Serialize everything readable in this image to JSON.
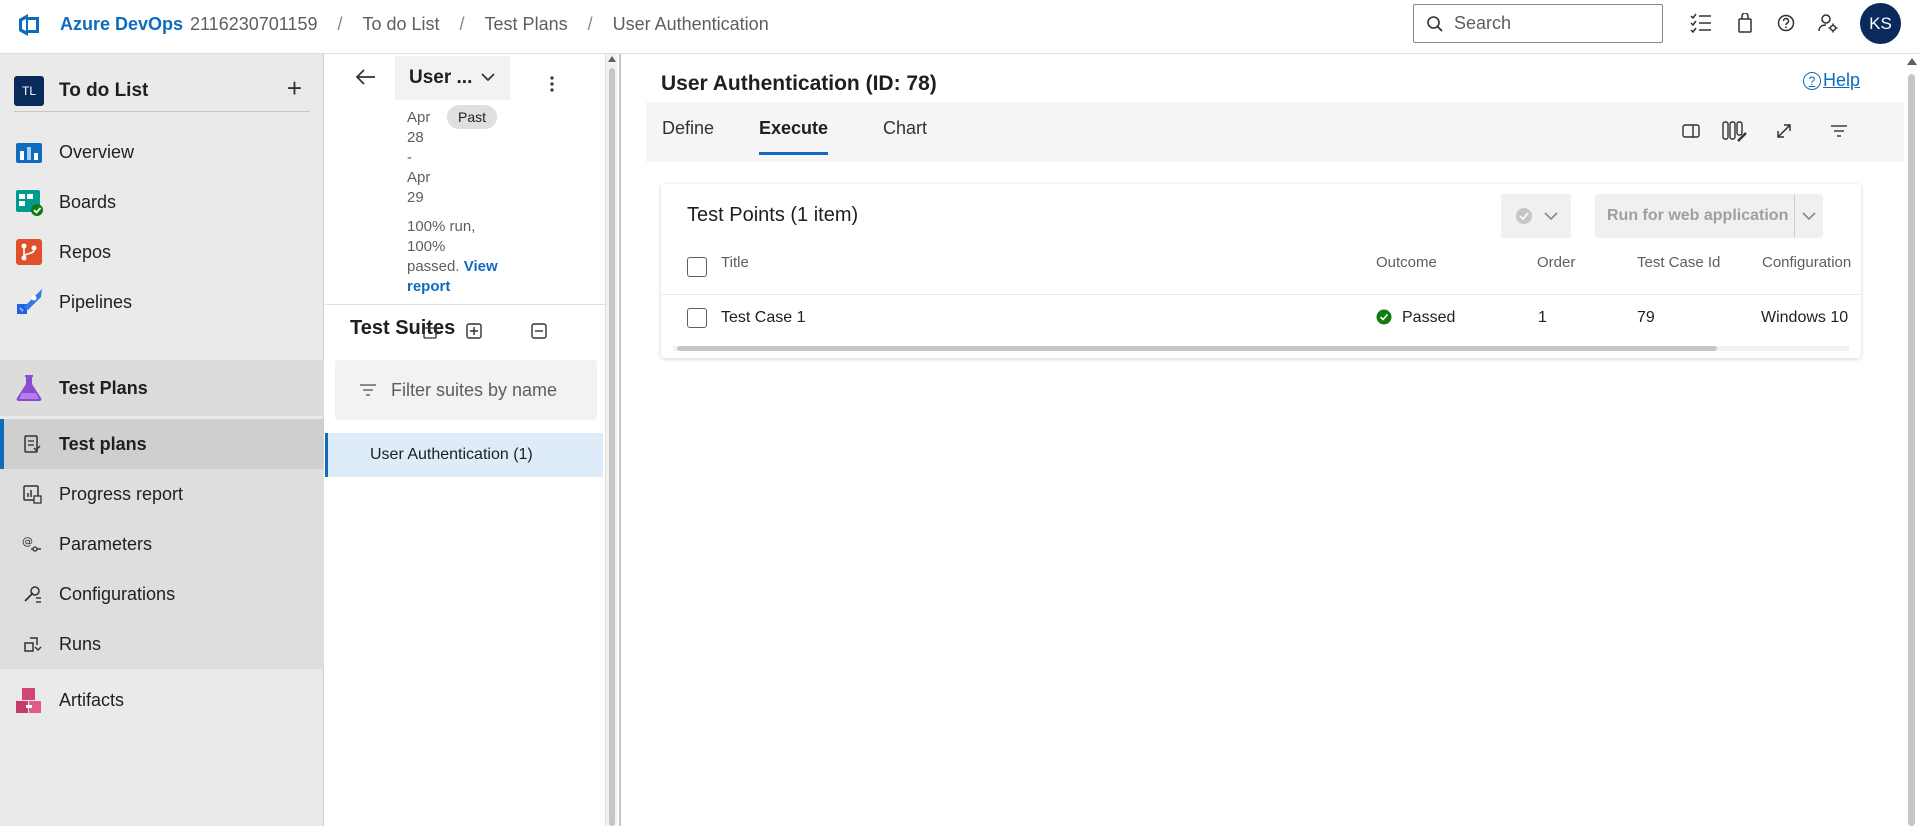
{
  "topbar": {
    "brand": "Azure DevOps",
    "breadcrumbs": [
      "2116230701159",
      "To do List",
      "Test Plans",
      "User Authentication"
    ],
    "search_placeholder": "Search",
    "avatar_initials": "KS",
    "icons": [
      "task-list-icon",
      "shopping-bag-icon",
      "help-icon",
      "user-settings-icon"
    ]
  },
  "leftnav": {
    "project_badge": "TL",
    "project_name": "To do List",
    "add_symbol": "+",
    "items": [
      {
        "label": "Overview",
        "icon": "overview-icon"
      },
      {
        "label": "Boards",
        "icon": "boards-icon"
      },
      {
        "label": "Repos",
        "icon": "repos-icon"
      },
      {
        "label": "Pipelines",
        "icon": "pipelines-icon"
      },
      {
        "label": "Test Plans",
        "icon": "test-plans-icon"
      },
      {
        "label": "Artifacts",
        "icon": "artifacts-icon"
      }
    ],
    "subitems": [
      {
        "label": "Test plans",
        "icon": "test-plans-doc-icon"
      },
      {
        "label": "Progress report",
        "icon": "progress-report-icon"
      },
      {
        "label": "Parameters",
        "icon": "parameters-icon"
      },
      {
        "label": "Configurations",
        "icon": "configurations-icon"
      },
      {
        "label": "Runs",
        "icon": "runs-icon"
      }
    ]
  },
  "plan_panel": {
    "plan_name": "User ...",
    "dates": [
      "Apr",
      "28",
      "-",
      "Apr",
      "29"
    ],
    "status_pill": "Past",
    "summary_lines": [
      "100% run,",
      "100%",
      "passed."
    ],
    "view_report": "View",
    "view_report_2": "report",
    "suites_title": "Test Suites",
    "filter_placeholder": "Filter suites by name",
    "suite_item": "User Authentication (1)"
  },
  "main": {
    "title": "User Authentication (ID: 78)",
    "help": "Help",
    "tabs": [
      "Define",
      "Execute",
      "Chart"
    ],
    "active_tab": "Execute",
    "card_title": "Test Points (1 item)",
    "run_button": "Run for web application",
    "columns": [
      "Title",
      "Outcome",
      "Order",
      "Test Case Id",
      "Configuration"
    ],
    "rows": [
      {
        "title": "Test Case 1",
        "outcome": "Passed",
        "order": "1",
        "test_case_id": "79",
        "configuration": "Windows 10"
      }
    ]
  },
  "colors": {
    "accent": "#0f6cbd",
    "passed": "#107c10",
    "nav_bg": "#eaeaea"
  }
}
